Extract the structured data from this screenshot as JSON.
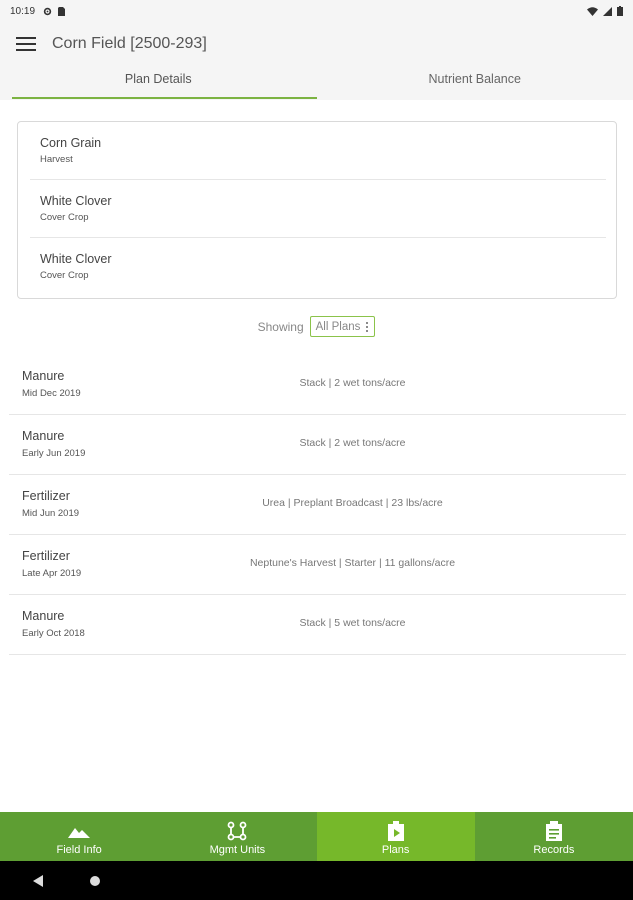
{
  "status": {
    "time": "10:19",
    "icons": [
      "settings-icon",
      "sim-card-icon",
      "wifi-icon",
      "signal-icon",
      "battery-icon"
    ]
  },
  "appbar": {
    "title": "Corn Field [2500-293]",
    "menu_icon": "hamburger-menu-icon"
  },
  "tabs": [
    {
      "label": "Plan Details",
      "active": true
    },
    {
      "label": "Nutrient Balance",
      "active": false
    }
  ],
  "crops": [
    {
      "name": "Corn Grain",
      "type": "Harvest"
    },
    {
      "name": "White Clover",
      "type": "Cover Crop"
    },
    {
      "name": "White Clover",
      "type": "Cover Crop"
    }
  ],
  "filter": {
    "label": "Showing",
    "value": "All Plans"
  },
  "plans": [
    {
      "title": "Manure",
      "date": "Mid Dec 2019",
      "detail": "Stack | 2 wet tons/acre"
    },
    {
      "title": "Manure",
      "date": "Early Jun 2019",
      "detail": "Stack | 2 wet tons/acre"
    },
    {
      "title": "Fertilizer",
      "date": "Mid Jun 2019",
      "detail": "Urea | Preplant Broadcast | 23 lbs/acre"
    },
    {
      "title": "Fertilizer",
      "date": "Late Apr 2019",
      "detail": "Neptune's Harvest | Starter | 11 gallons/acre"
    },
    {
      "title": "Manure",
      "date": "Early Oct 2018",
      "detail": "Stack | 5 wet tons/acre"
    }
  ],
  "bottom_nav": [
    {
      "label": "Field Info",
      "icon": "mountain-icon",
      "active": false
    },
    {
      "label": "Mgmt Units",
      "icon": "units-graph-icon",
      "active": false
    },
    {
      "label": "Plans",
      "icon": "plans-play-icon",
      "active": true
    },
    {
      "label": "Records",
      "icon": "clipboard-icon",
      "active": false
    }
  ],
  "colors": {
    "accent": "#7cb342",
    "nav_bg": "#5e9e33",
    "nav_active": "#76b82a"
  }
}
